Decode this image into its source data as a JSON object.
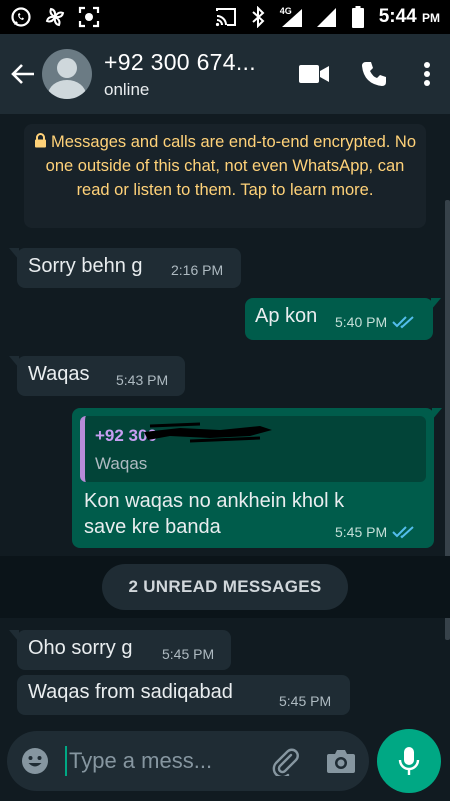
{
  "colors": {
    "header": "#1f2c34",
    "chat_bg": "#111b21",
    "incoming": "#1f2c34",
    "outgoing": "#005c4b",
    "accent": "#00a884",
    "notice_text": "#ffd279",
    "read_ticks": "#53bdeb"
  },
  "status_bar": {
    "icons_left": [
      "whatsapp-icon",
      "pinwheel-icon",
      "screenshot-icon"
    ],
    "icons_right": [
      "cast-icon",
      "bluetooth-icon",
      "signal-4g-icon",
      "signal-icon",
      "battery-icon"
    ],
    "network_label": "4G",
    "time": "5:44",
    "ampm": "PM"
  },
  "header": {
    "contact_name": "+92 300 674...",
    "status": "online",
    "actions": [
      "video-call-icon",
      "phone-icon",
      "more-vert-icon"
    ]
  },
  "encryption_notice": "Messages and calls are end-to-end encrypted. No one outside of this chat, not even WhatsApp, can read or listen to them. Tap to learn more.",
  "messages": [
    {
      "dir": "in",
      "text": "Sorry behn g",
      "time": "2:16 PM"
    },
    {
      "dir": "out",
      "text": "Ap kon",
      "time": "5:40 PM",
      "ticks": "read"
    },
    {
      "dir": "in",
      "text": "Waqas",
      "time": "5:43 PM"
    },
    {
      "dir": "out",
      "quote_author": "+92 300",
      "quote_text": "Waqas",
      "text_line1": "Kon waqas no ankhein khol k",
      "text_line2": "save kre banda",
      "time": "5:45 PM",
      "ticks": "read"
    },
    {
      "dir": "in",
      "text": "Oho sorry g",
      "time": "5:45 PM"
    },
    {
      "dir": "in",
      "text": "Waqas from sadiqabad",
      "time": "5:45 PM"
    }
  ],
  "unread_label": "2 UNREAD MESSAGES",
  "composer": {
    "placeholder": "Type a mess...",
    "value": "",
    "icons": [
      "emoji-icon",
      "attach-icon",
      "camera-icon",
      "mic-icon"
    ]
  }
}
